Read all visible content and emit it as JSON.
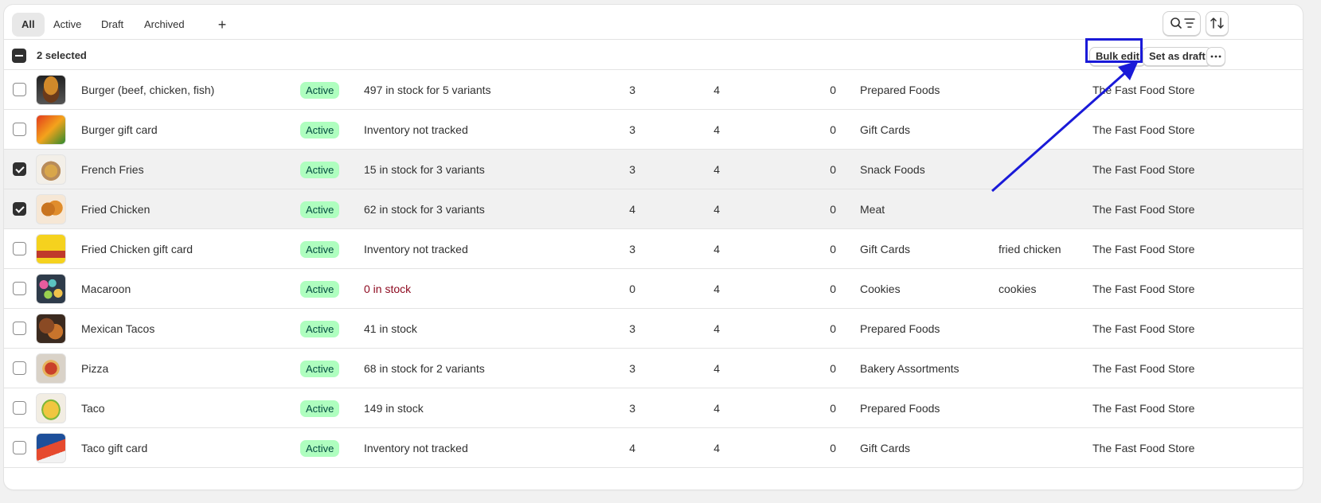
{
  "tabs": [
    {
      "label": "All"
    },
    {
      "label": "Active"
    },
    {
      "label": "Draft"
    },
    {
      "label": "Archived"
    }
  ],
  "add_tab_label": "+",
  "selection": {
    "text": "2 selected",
    "bulk_edit_label": "Bulk edit",
    "set_draft_label": "Set as draft"
  },
  "icons": [
    "search-icon",
    "filter-icon",
    "sort-icon",
    "more-actions-icon"
  ],
  "colors": {
    "active_badge_bg": "#affebf",
    "active_badge_text": "#014b40",
    "out_of_stock": "#8e0b21",
    "annotation": "#1a1ad8"
  },
  "rows": [
    {
      "name": "Burger (beef, chicken, fish)",
      "status": "Active",
      "inventory": "497 in stock for 5 variants",
      "c1": "3",
      "c2": "4",
      "c3": "0",
      "category": "Prepared Foods",
      "tags": "",
      "vendor": "The Fast Food Store",
      "selected": false,
      "thumb": "burger"
    },
    {
      "name": "Burger gift card",
      "status": "Active",
      "inventory": "Inventory not tracked",
      "c1": "3",
      "c2": "4",
      "c3": "0",
      "category": "Gift Cards",
      "tags": "",
      "vendor": "The Fast Food Store",
      "selected": false,
      "thumb": "burger-card"
    },
    {
      "name": "French Fries",
      "status": "Active",
      "inventory": "15 in stock for 3 variants",
      "c1": "3",
      "c2": "4",
      "c3": "0",
      "category": "Snack Foods",
      "tags": "",
      "vendor": "The Fast Food Store",
      "selected": true,
      "thumb": "fries"
    },
    {
      "name": "Fried Chicken",
      "status": "Active",
      "inventory": "62 in stock for 3 variants",
      "c1": "4",
      "c2": "4",
      "c3": "0",
      "category": "Meat",
      "tags": "",
      "vendor": "The Fast Food Store",
      "selected": true,
      "thumb": "chicken"
    },
    {
      "name": "Fried Chicken gift card",
      "status": "Active",
      "inventory": "Inventory not tracked",
      "c1": "3",
      "c2": "4",
      "c3": "0",
      "category": "Gift Cards",
      "tags": "fried chicken",
      "vendor": "The Fast Food Store",
      "selected": false,
      "thumb": "chicken-card"
    },
    {
      "name": "Macaroon",
      "status": "Active",
      "inventory": "0 in stock",
      "c1": "0",
      "c2": "4",
      "c3": "0",
      "category": "Cookies",
      "tags": "cookies",
      "vendor": "The Fast Food Store",
      "selected": false,
      "thumb": "macaroon",
      "out_of_stock": true
    },
    {
      "name": "Mexican Tacos",
      "status": "Active",
      "inventory": "41 in stock",
      "c1": "3",
      "c2": "4",
      "c3": "0",
      "category": "Prepared Foods",
      "tags": "",
      "vendor": "The Fast Food Store",
      "selected": false,
      "thumb": "tacos"
    },
    {
      "name": "Pizza",
      "status": "Active",
      "inventory": "68 in stock for 2 variants",
      "c1": "3",
      "c2": "4",
      "c3": "0",
      "category": "Bakery Assortments",
      "tags": "",
      "vendor": "The Fast Food Store",
      "selected": false,
      "thumb": "pizza"
    },
    {
      "name": "Taco",
      "status": "Active",
      "inventory": "149 in stock",
      "c1": "3",
      "c2": "4",
      "c3": "0",
      "category": "Prepared Foods",
      "tags": "",
      "vendor": "The Fast Food Store",
      "selected": false,
      "thumb": "taco"
    },
    {
      "name": "Taco gift card",
      "status": "Active",
      "inventory": "Inventory not tracked",
      "c1": "4",
      "c2": "4",
      "c3": "0",
      "category": "Gift Cards",
      "tags": "",
      "vendor": "The Fast Food Store",
      "selected": false,
      "thumb": "taco-card"
    }
  ]
}
